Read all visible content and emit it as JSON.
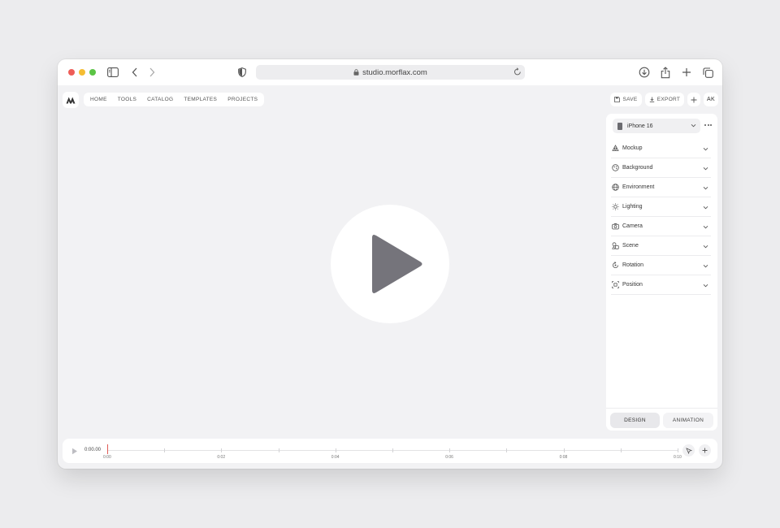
{
  "browser": {
    "url": "studio.morflax.com"
  },
  "nav": {
    "items": [
      "HOME",
      "TOOLS",
      "CATALOG",
      "TEMPLATES",
      "PROJECTS"
    ]
  },
  "actions": {
    "save_label": "SAVE",
    "export_label": "EXPORT",
    "avatar_initials": "AK"
  },
  "panel": {
    "device": "iPhone 16",
    "sections": [
      {
        "label": "Mockup",
        "icon": "mockup-icon"
      },
      {
        "label": "Background",
        "icon": "background-icon"
      },
      {
        "label": "Environment",
        "icon": "globe-icon"
      },
      {
        "label": "Lighting",
        "icon": "sun-icon"
      },
      {
        "label": "Camera",
        "icon": "camera-icon"
      },
      {
        "label": "Scene",
        "icon": "shapes-icon"
      },
      {
        "label": "Rotation",
        "icon": "rotate-icon"
      },
      {
        "label": "Position",
        "icon": "move-icon"
      }
    ],
    "tabs": {
      "design": "DESIGN",
      "animation": "ANIMATION",
      "active": "DESIGN"
    }
  },
  "timeline": {
    "current_time": "0:00.00",
    "labels": [
      "0:00",
      "0:02",
      "0:04",
      "0:06",
      "0:08",
      "0:10"
    ]
  },
  "colors": {
    "red": "#ee5d58",
    "yellow": "#f5bd33",
    "green": "#5bc445",
    "play_icon": "#75747b",
    "playhead": "#e05a55"
  }
}
